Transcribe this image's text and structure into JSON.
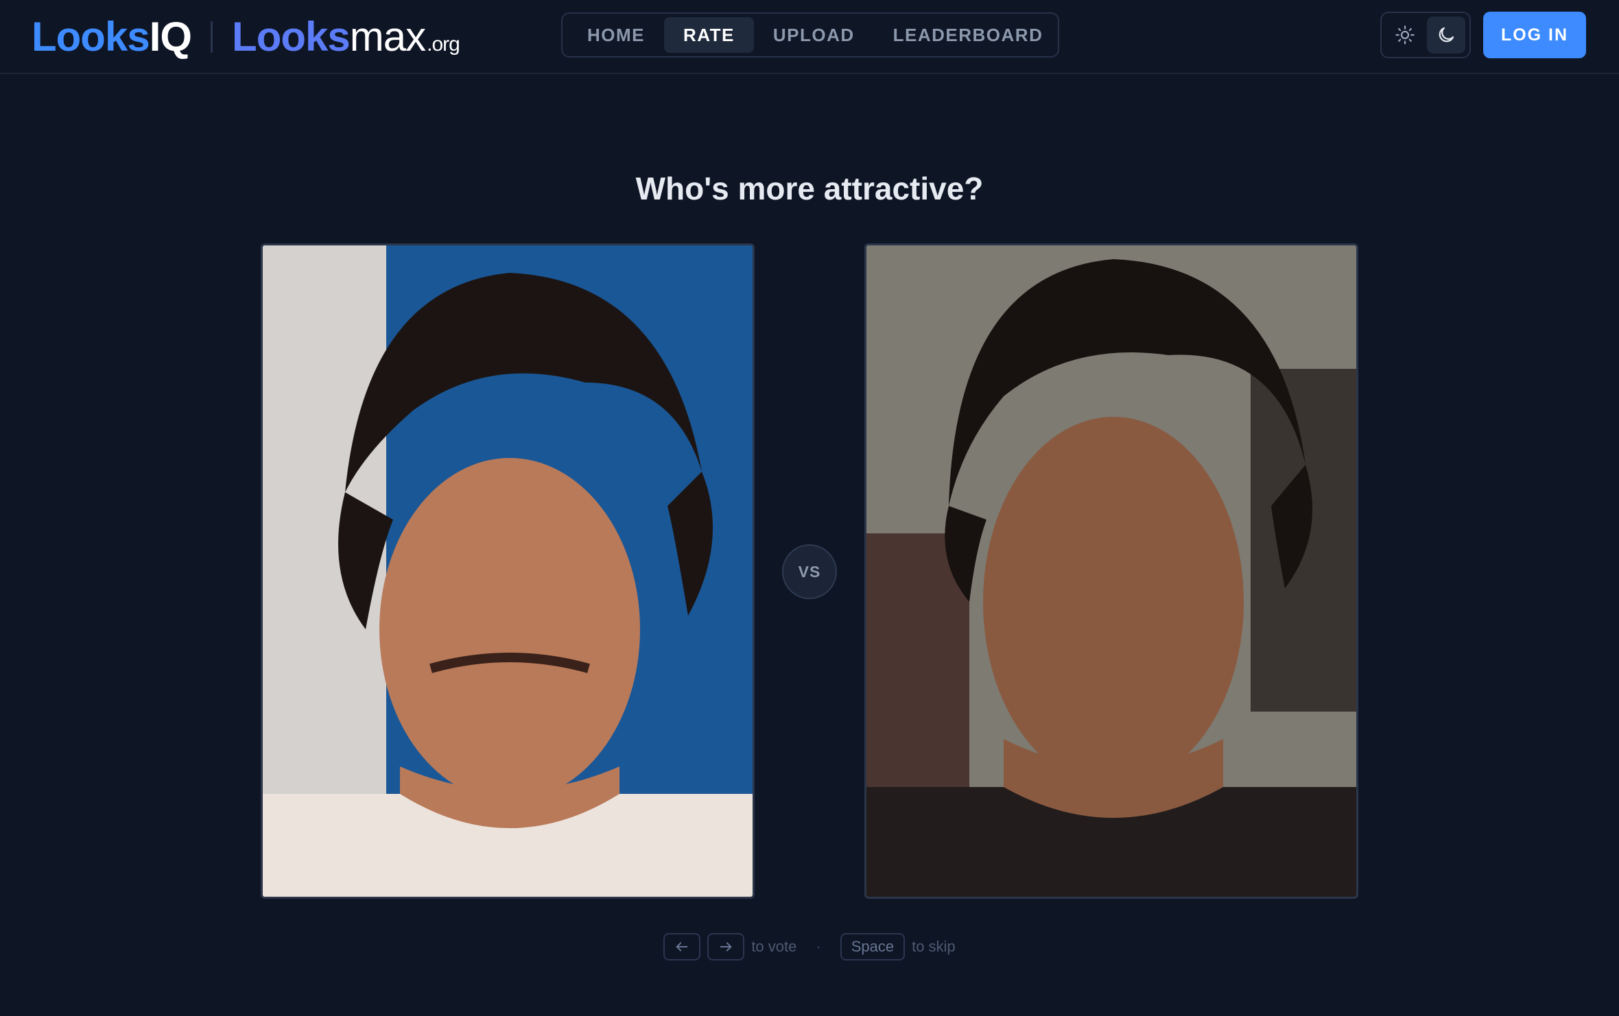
{
  "header": {
    "logo_primary": {
      "part1": "Looks",
      "part2": "IQ"
    },
    "logo_secondary": {
      "part1": "Looks",
      "part2": "max",
      "part3": ".org"
    },
    "nav": [
      {
        "label": "HOME",
        "active": false
      },
      {
        "label": "RATE",
        "active": true
      },
      {
        "label": "UPLOAD",
        "active": false
      },
      {
        "label": "LEADERBOARD",
        "active": false
      }
    ],
    "theme": {
      "light_icon": "sun-icon",
      "dark_icon": "moon-icon",
      "selected": "dark"
    },
    "login_label": "LOG IN"
  },
  "main": {
    "title": "Who's more attractive?",
    "vs_label": "VS",
    "left_photo": {
      "icon": "portrait-photo"
    },
    "right_photo": {
      "icon": "portrait-photo"
    }
  },
  "hints": {
    "left_key_icon": "arrow-left-icon",
    "right_key_icon": "arrow-right-icon",
    "vote_text": "to vote",
    "separator": "·",
    "space_key": "Space",
    "skip_text": "to skip"
  },
  "colors": {
    "background": "#0e1525",
    "accent": "#3d8bff",
    "logo_secondary": "#5b7cf6"
  }
}
